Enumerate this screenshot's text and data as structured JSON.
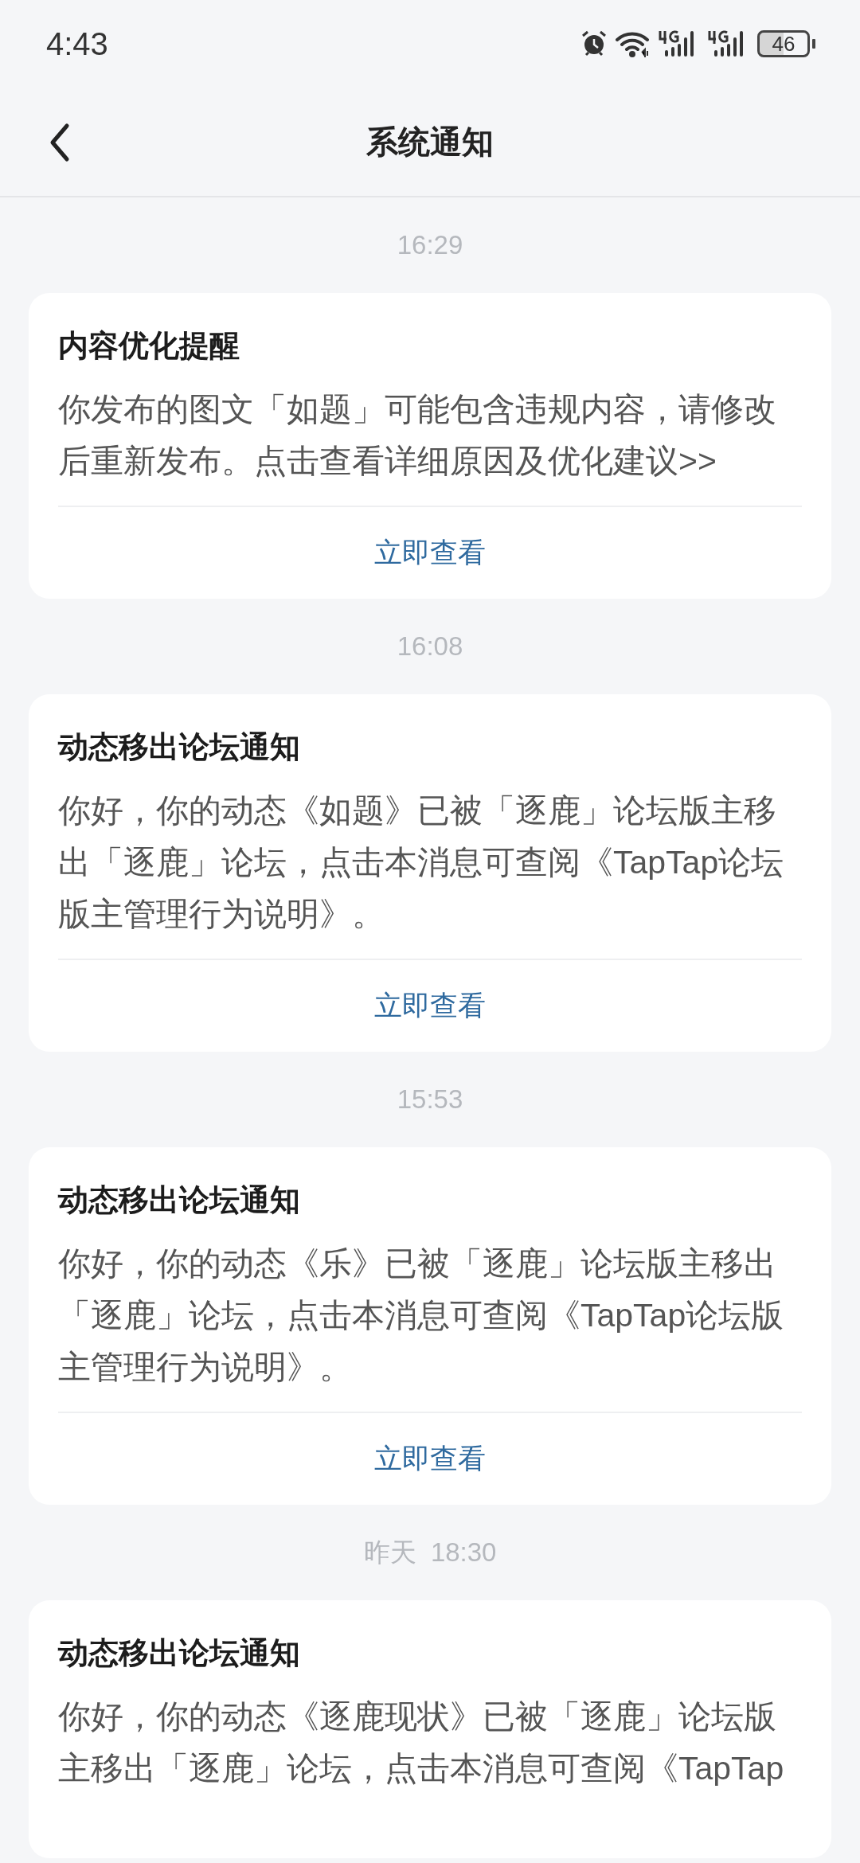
{
  "status_bar": {
    "time": "4:43",
    "battery": "46"
  },
  "header": {
    "title": "系统通知"
  },
  "notifications": [
    {
      "time": "16:29",
      "title": "内容优化提醒",
      "body": "你发布的图文「如题」可能包含违规内容，请修改后重新发布。点击查看详细原因及优化建议>>",
      "action": "立即查看"
    },
    {
      "time": "16:08",
      "title": "动态移出论坛通知",
      "body": "你好，你的动态《如题》已被「逐鹿」论坛版主移出「逐鹿」论坛，点击本消息可查阅《TapTap论坛版主管理行为说明》。",
      "action": "立即查看"
    },
    {
      "time": "15:53",
      "title": "动态移出论坛通知",
      "body": "你好，你的动态《乐》已被「逐鹿」论坛版主移出「逐鹿」论坛，点击本消息可查阅《TapTap论坛版主管理行为说明》。",
      "action": "立即查看"
    },
    {
      "day": "昨天",
      "time": "18:30",
      "title": "动态移出论坛通知",
      "body": "你好，你的动态《逐鹿现状》已被「逐鹿」论坛版主移出「逐鹿」论坛，点击本消息可查阅《TapTap"
    }
  ]
}
